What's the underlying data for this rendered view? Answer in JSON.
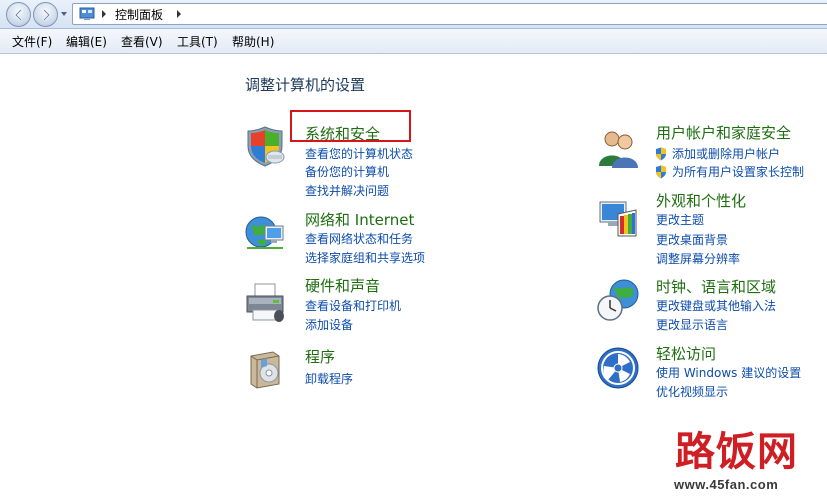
{
  "address_bar": {
    "path": "控制面板"
  },
  "menu": [
    {
      "label": "文件(F)"
    },
    {
      "label": "编辑(E)"
    },
    {
      "label": "查看(V)"
    },
    {
      "label": "工具(T)"
    },
    {
      "label": "帮助(H)"
    }
  ],
  "main": {
    "title": "调整计算机的设置",
    "left": [
      {
        "icon": "shield-icon",
        "title": "系统和安全",
        "links": [
          "查看您的计算机状态",
          "备份您的计算机",
          "查找并解决问题"
        ]
      },
      {
        "icon": "network-globe-icon",
        "title": "网络和 Internet",
        "links": [
          "查看网络状态和任务",
          "选择家庭组和共享选项"
        ]
      },
      {
        "icon": "printer-icon",
        "title": "硬件和声音",
        "links": [
          "查看设备和打印机",
          "添加设备"
        ]
      },
      {
        "icon": "programs-box-icon",
        "title": "程序",
        "links": [
          "卸载程序"
        ]
      }
    ],
    "right": [
      {
        "icon": "users-icon",
        "title": "用户帐户和家庭安全",
        "links": [
          "添加或删除用户帐户",
          "为所有用户设置家长控制"
        ]
      },
      {
        "icon": "display-palette-icon",
        "title": "外观和个性化",
        "links": [
          "更改主题",
          "更改桌面背景",
          "调整屏幕分辨率"
        ]
      },
      {
        "icon": "clock-globe-icon",
        "title": "时钟、语言和区域",
        "links": [
          "更改键盘或其他输入法",
          "更改显示语言"
        ]
      },
      {
        "icon": "ease-of-access-icon",
        "title": "轻松访问",
        "links": [
          "使用 Windows 建议的设置",
          "优化视频显示"
        ]
      }
    ]
  },
  "watermark": {
    "logo_text": "路饭网",
    "url": "www.45fan.com"
  },
  "colors": {
    "category_title": "#1e6e10",
    "link": "#0e4dab",
    "highlight": "#d7141a"
  }
}
